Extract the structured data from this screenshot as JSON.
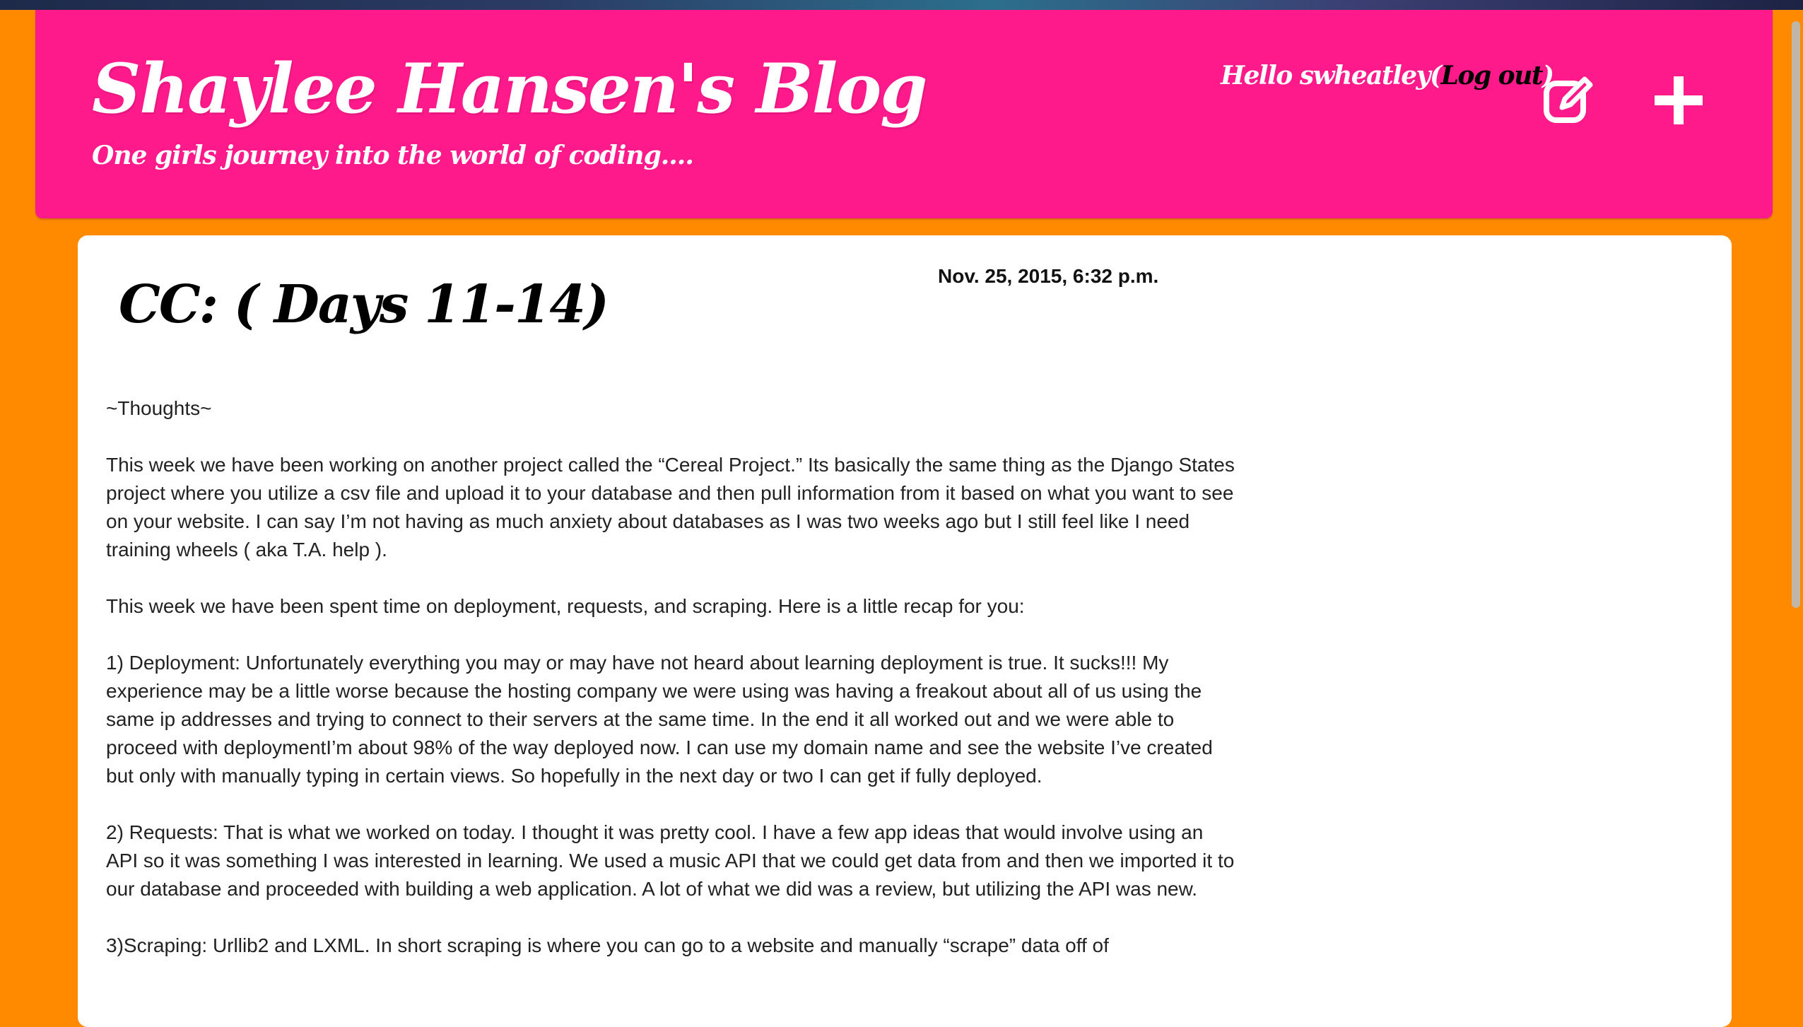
{
  "header": {
    "blog_title": "Shaylee Hansen's Blog",
    "subtitle": "One girls journey into the world of coding....",
    "greeting_prefix": "Hello swheatley",
    "logout_open": "(",
    "logout_label": "Log out",
    "logout_close": ")",
    "edit_icon": "edit-icon",
    "add_icon": "plus-icon"
  },
  "post": {
    "title": "CC: ( Days 11-14)",
    "date": "Nov. 25, 2015, 6:32 p.m.",
    "paragraphs": [
      "~Thoughts~",
      "This week we have been working on another project called the “Cereal Project.” Its basically the same thing as the Django States project where you utilize a csv file and upload it to your database and then pull information from it based on what you want to see on your website. I can say I’m not having as much anxiety about databases as I was two weeks ago but I still feel like I need training wheels ( aka T.A. help ).",
      "This week we have been spent time on deployment, requests, and scraping. Here is a little recap for you:",
      "1) Deployment: Unfortunately everything you may or may have not heard about learning deployment is true. It sucks!!! My experience may be a little worse because the hosting company we were using was having a freakout about all of us using the same ip addresses and trying to connect to their servers at the same time. In the end it all worked out and we were able to proceed with deploymentI’m about 98% of the way deployed now. I can use my domain name and see the website I’ve created but only with manually typing in certain views. So hopefully in the next day or two I can get if fully deployed.",
      "2) Requests: That is what we worked on today. I thought it was pretty cool. I have a few app ideas that would involve using an API so it was something I was interested in learning. We used a music API that we could get data from and then we imported it to our database and proceeded with building a web application. A lot of what we did was a review, but utilizing the API was new.",
      "3)Scraping: Urllib2 and LXML. In short scraping is where you can go to a website and manually “scrape” data off of"
    ]
  },
  "colors": {
    "page_background": "#ff8a00",
    "header_background": "#ff1a8c",
    "card_background": "#ffffff",
    "logout_color": "#000000"
  }
}
